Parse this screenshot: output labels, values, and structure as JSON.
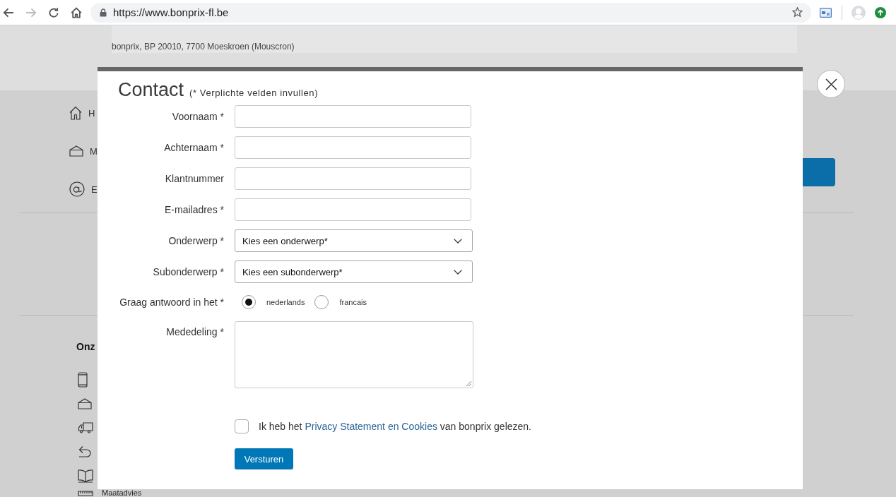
{
  "browser": {
    "nav": [
      {
        "kind": "back",
        "disabled": false
      },
      {
        "kind": "forward",
        "disabled": true
      },
      {
        "kind": "reload",
        "disabled": false
      },
      {
        "kind": "home",
        "disabled": false
      }
    ],
    "address": "https://www.bonprix-fl.be"
  },
  "page": {
    "address_line": "bonprix, BP 20010, 7700 Moeskroen (Mouscron)",
    "menu": [
      {
        "kind": "home",
        "label": "H"
      },
      {
        "kind": "mail",
        "label": "M"
      },
      {
        "kind": "email",
        "label": "E"
      }
    ],
    "section_heading": "Onz",
    "service_items": [
      {
        "kind": "phone"
      },
      {
        "kind": "package"
      },
      {
        "kind": "truck"
      },
      {
        "kind": "return"
      },
      {
        "kind": "book"
      },
      {
        "kind": "ruler",
        "label": "Maatadvies"
      }
    ]
  },
  "dialog": {
    "title": "Contact",
    "note": "(* Verplichte velden invullen)",
    "fields": [
      {
        "kind": "text",
        "label": "Voornaam *"
      },
      {
        "kind": "text",
        "label": "Achternaam *"
      },
      {
        "kind": "text",
        "label": "Klantnummer"
      },
      {
        "kind": "text",
        "label": "E-mailadres *"
      },
      {
        "kind": "select",
        "label": "Onderwerp *",
        "value": "Kies een onderwerp*"
      },
      {
        "kind": "select",
        "label": "Subonderwerp *",
        "value": "Kies een subonderwerp*"
      },
      {
        "kind": "radio",
        "label": "Graag antwoord in het *",
        "options": [
          {
            "label": "nederlands",
            "selected": true
          },
          {
            "label": "francais",
            "selected": false
          }
        ]
      },
      {
        "kind": "textarea",
        "label": "Mededeling *"
      }
    ],
    "consent": {
      "checked": false,
      "before": "Ik heb het",
      "link": "Privacy Statement en Cookies",
      "after": "van bonprix gelezen."
    },
    "submit": "Versturen"
  }
}
